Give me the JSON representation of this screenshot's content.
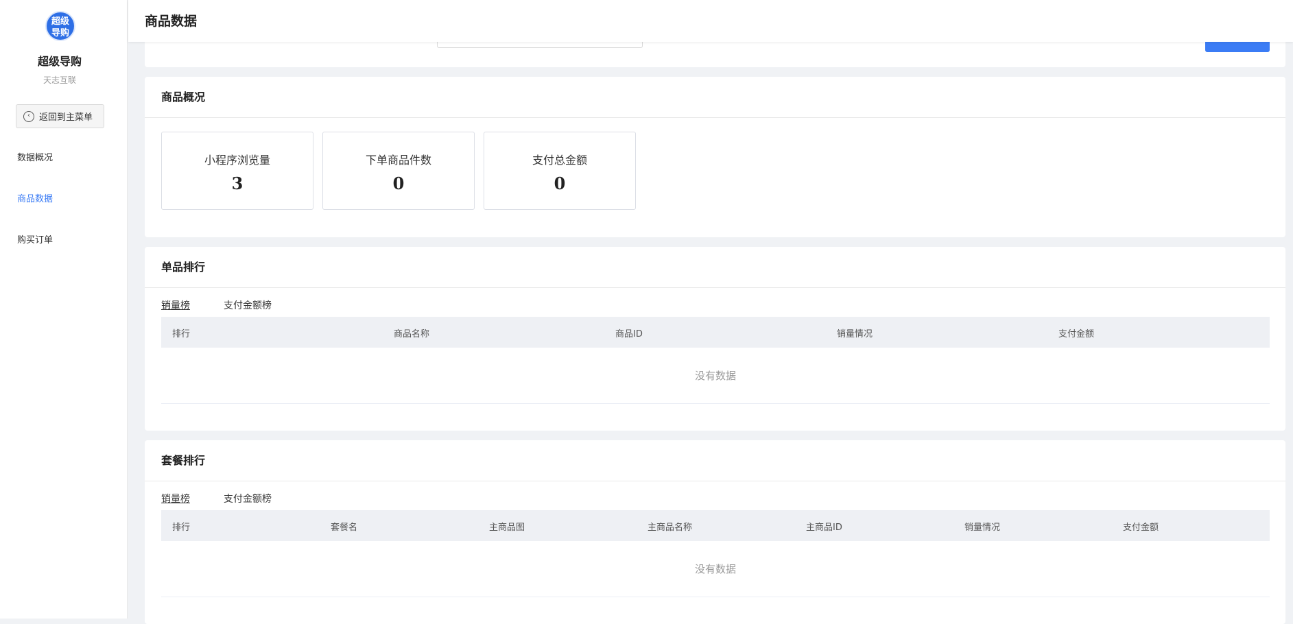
{
  "sidebar": {
    "logo": [
      "超级",
      "导购"
    ],
    "app_name": "超级导购",
    "org_name": "天志互联",
    "back_label": "返回到主菜单",
    "items": [
      {
        "label": "数据概况",
        "active": false
      },
      {
        "label": "商品数据",
        "active": true
      },
      {
        "label": "购买订单",
        "active": false
      }
    ]
  },
  "header": {
    "title": "商品数据"
  },
  "overview": {
    "title": "商品概况",
    "stats": [
      {
        "label": "小程序浏览量",
        "value": "3"
      },
      {
        "label": "下单商品件数",
        "value": "0"
      },
      {
        "label": "支付总金额",
        "value": "0"
      }
    ]
  },
  "single_rank": {
    "title": "单品排行",
    "tabs": [
      "销量榜",
      "支付金额榜"
    ],
    "columns": [
      "排行",
      "商品名称",
      "商品ID",
      "销量情况",
      "支付金额"
    ],
    "empty_text": "没有数据"
  },
  "package_rank": {
    "title": "套餐排行",
    "tabs": [
      "销量榜",
      "支付金额榜"
    ],
    "columns": [
      "排行",
      "套餐名",
      "主商品图",
      "主商品名称",
      "主商品ID",
      "销量情况",
      "支付金额"
    ],
    "empty_text": "没有数据"
  },
  "colors": {
    "accent": "#3b7cf5",
    "logo": "#2e6fe6"
  }
}
